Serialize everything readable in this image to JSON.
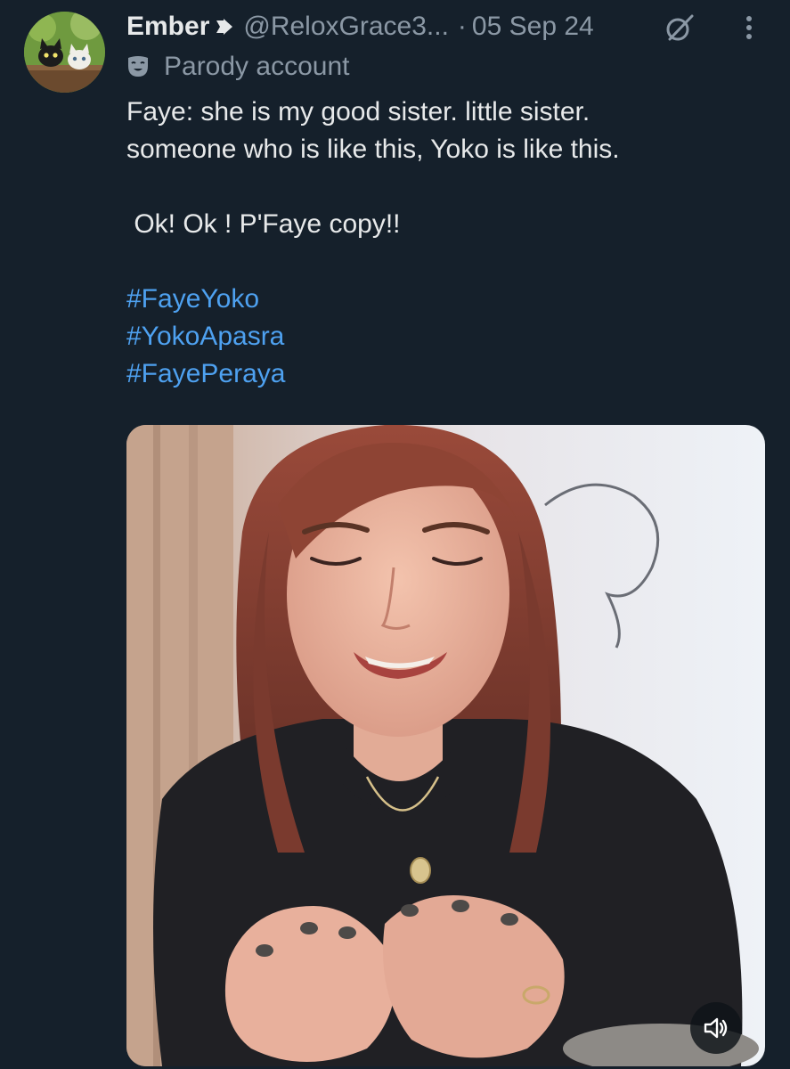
{
  "author": {
    "display_name": "Ember",
    "badge_icon": "heart-arrow-icon",
    "handle": "@ReloxGrace3...",
    "separator": "·",
    "date": "05 Sep 24",
    "label_icon": "theater-mask-icon",
    "label": "Parody account",
    "avatar_icon": "cats-avatar"
  },
  "header_icons": {
    "grok": "grok-icon",
    "more": "more-options-icon"
  },
  "tweet": {
    "lines": [
      "Faye: she is my good sister. little sister.",
      "someone who is like this, Yoko is like this."
    ],
    "reply": " Ok! Ok ! P'Faye copy!!",
    "hashtags": [
      "#FayeYoko",
      "#YokoApasra",
      "#FayePeraya"
    ]
  },
  "media": {
    "type": "video",
    "volume_icon": "speaker-icon"
  },
  "colors": {
    "background": "#15202b",
    "text": "#e7e9ea",
    "secondary": "#8b98a5",
    "hashtag": "#4ea1f0"
  }
}
